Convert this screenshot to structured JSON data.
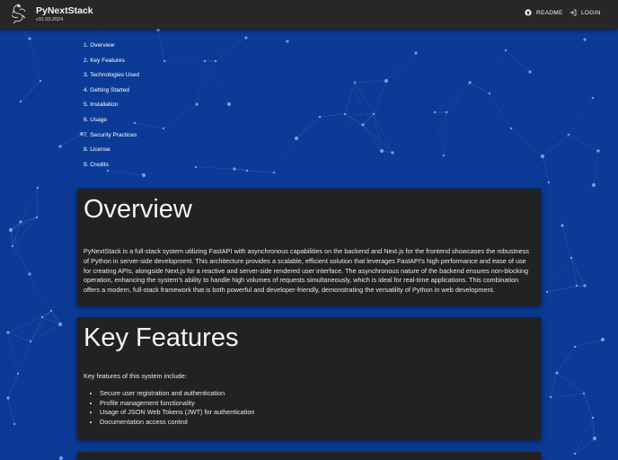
{
  "header": {
    "title": "PyNextStack",
    "version": "v31.03.2024",
    "readme_label": "README",
    "login_label": "LOGIN"
  },
  "toc": [
    "1. Overview",
    "2. Key Features",
    "3. Technologies Used",
    "4. Getting Started",
    "5. Installation",
    "6. Usage",
    "7. Security Practices",
    "8. License",
    "9. Credits"
  ],
  "overview": {
    "title": "Overview",
    "body": "PyNextStack is a full-stack system utilizing FastAPI with asynchronous capabilities on the backend and Next.js for the frontend showcases the robustness of Python in server-side development. This architecture provides a scalable, efficient solution that leverages FastAPI's high performance and ease of use for creating APIs, alongside Next.js for a reactive and server-side rendered user interface. The asynchronous nature of the backend ensures non-blocking operation, enhancing the system's ability to handle high volumes of requests simultaneously, which is ideal for real-time applications. This combination offers a modern, full-stack framework that is both powerful and developer-friendly, demonstrating the versatility of Python in web development."
  },
  "features": {
    "title": "Key Features",
    "intro": "Key features of this system include:",
    "items": [
      "Secure user registration and authentication",
      "Profile management functionality",
      "Usage of JSON Web Tokens (JWT) for authentication",
      "Documentation access control"
    ]
  },
  "colors": {
    "background": "#0b3b96",
    "appbar": "#272727",
    "card": "#222222",
    "particle": "#8fb3ff"
  },
  "icons": {
    "logo": "python-snake-logo",
    "readme": "github-icon",
    "login": "login-icon"
  }
}
